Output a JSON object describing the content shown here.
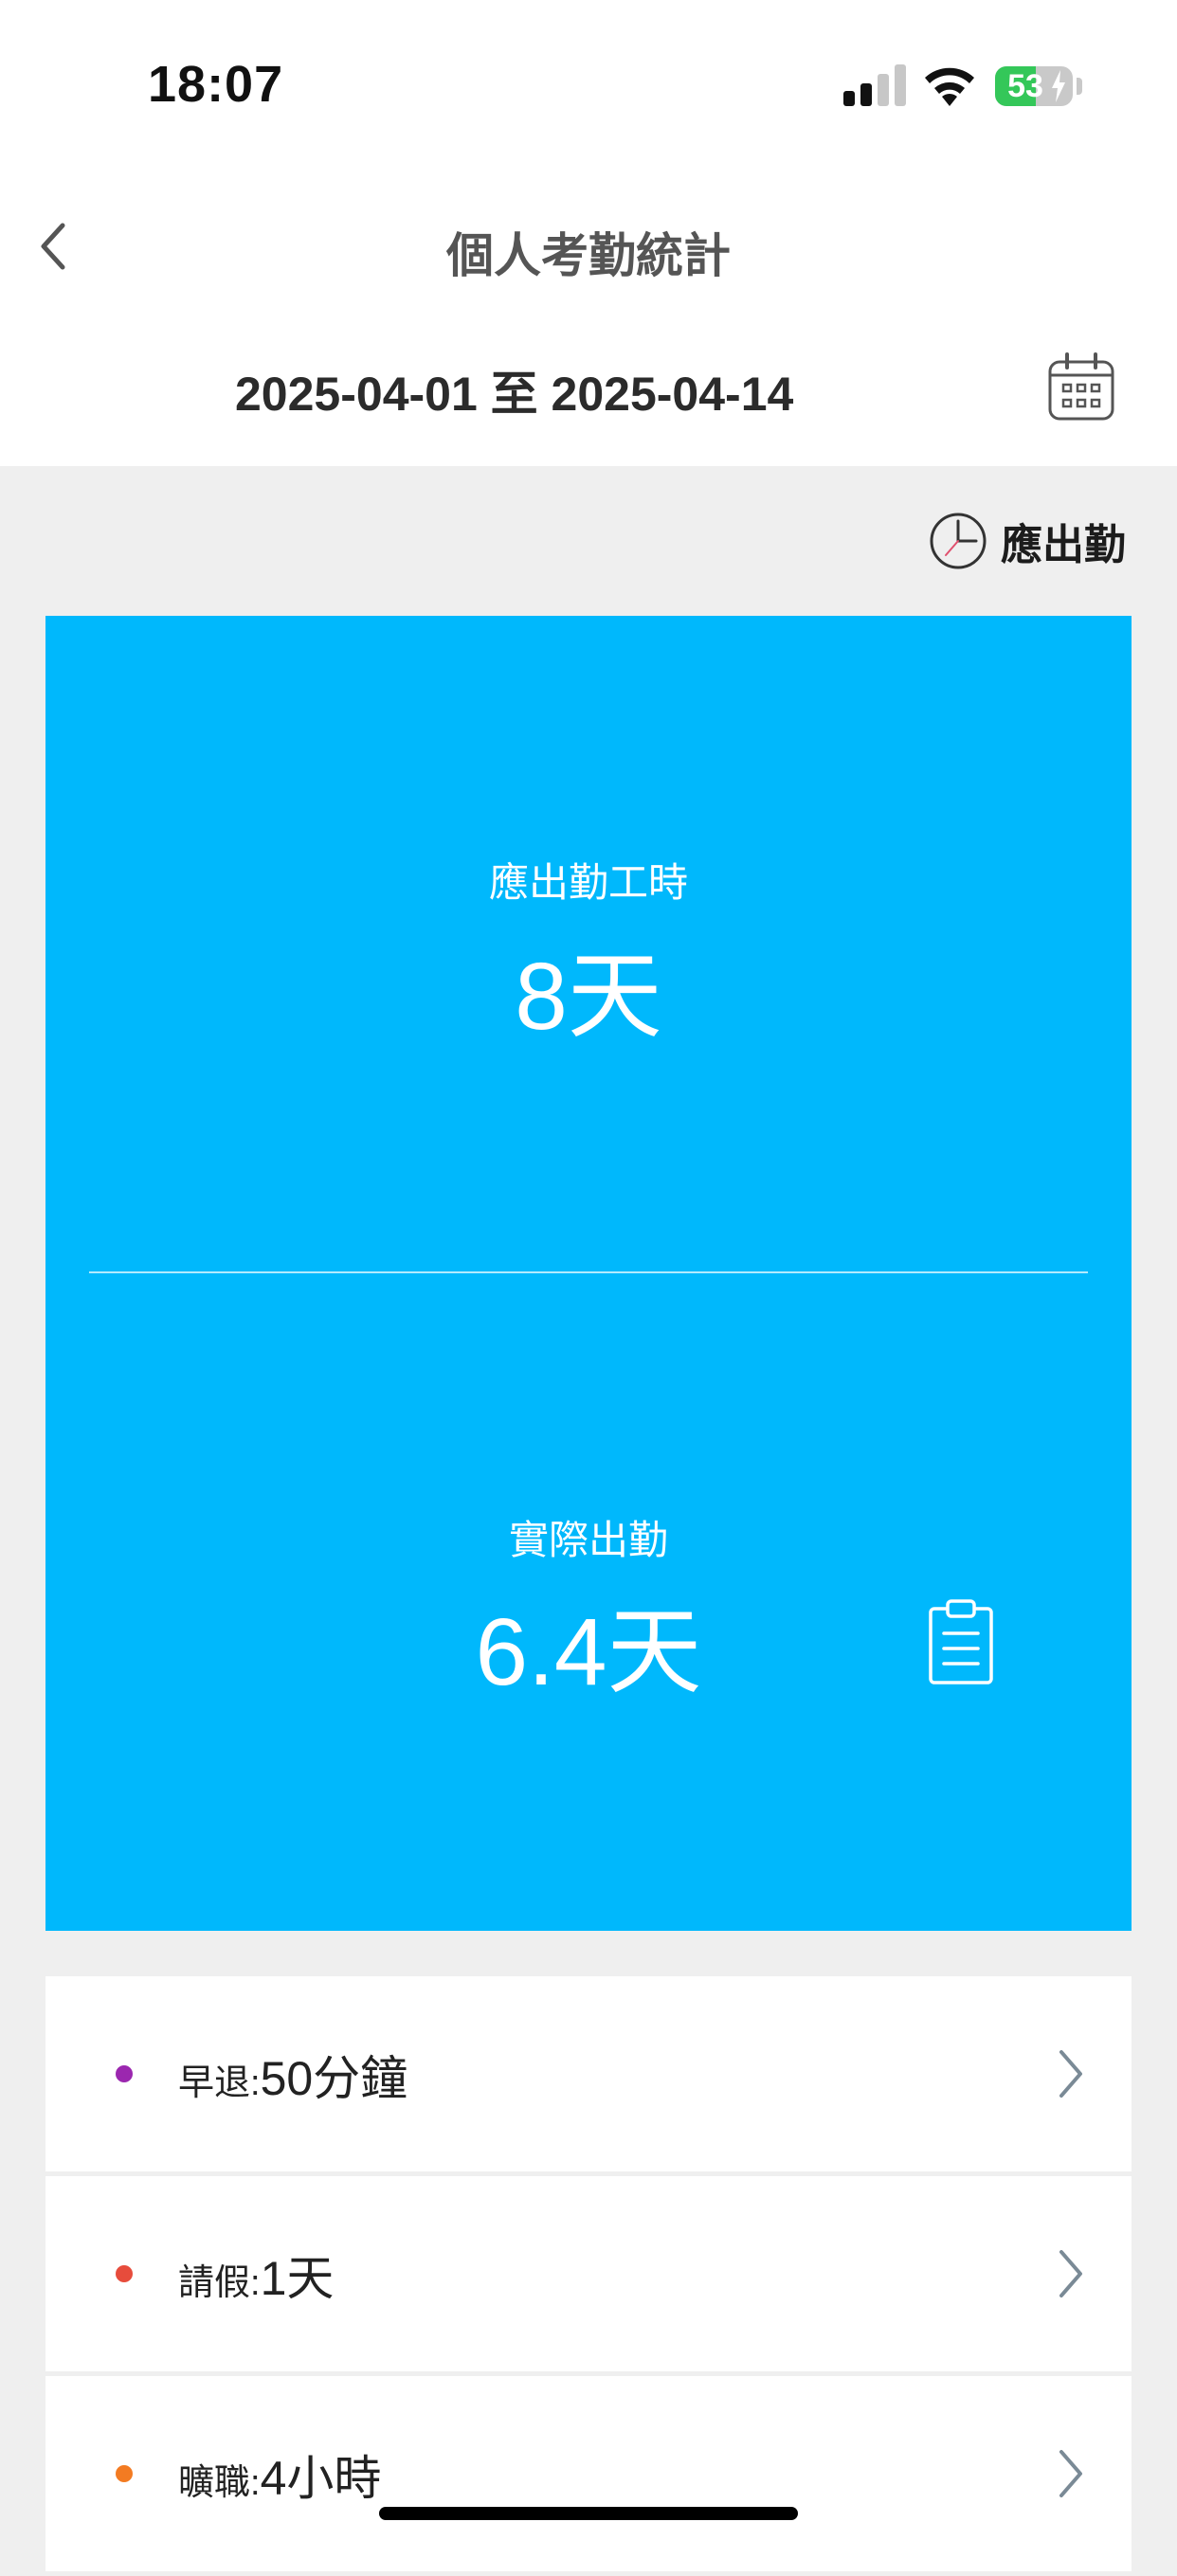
{
  "status_bar": {
    "time": "18:07",
    "battery_level": "53",
    "battery_percent": 53,
    "battery_color": "#34c759",
    "icons": [
      "cellular-signal-icon",
      "wifi-icon",
      "battery-charging-icon"
    ]
  },
  "nav": {
    "title": "個人考勤統計",
    "back_icon": "chevron-left-icon"
  },
  "date_filter": {
    "range": "2025-04-01 至 2025-04-14",
    "icon": "calendar-icon"
  },
  "legend": {
    "label": "應出勤",
    "icon": "clock-icon"
  },
  "summary": {
    "background_color": "#00b8fc",
    "expected": {
      "title": "應出勤工時",
      "value": "8天"
    },
    "actual": {
      "title": "實際出勤",
      "value": "6.4天",
      "icon": "clipboard-icon"
    }
  },
  "details": [
    {
      "label": "早退:",
      "value": "50分鐘",
      "color": "#9b27af",
      "icon": "chevron-right-icon"
    },
    {
      "label": "請假:",
      "value": "1天",
      "color": "#e74c3c",
      "icon": "chevron-right-icon"
    },
    {
      "label": "曠職:",
      "value": "4小時",
      "color": "#f37b22",
      "icon": "chevron-right-icon"
    }
  ]
}
